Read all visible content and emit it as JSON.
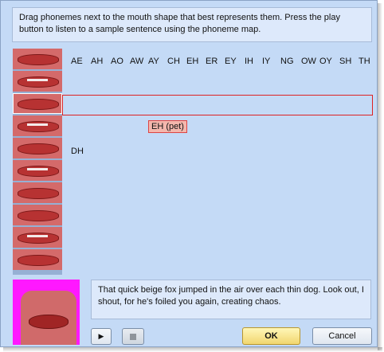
{
  "instructions": "Drag phonemes next to the mouth shape that best represents them. Press the play button to listen to a sample sentence using the phoneme map.",
  "phonemes": [
    "AE",
    "AH",
    "AO",
    "AW",
    "AY",
    "CH",
    "EH",
    "ER",
    "EY",
    "IH",
    "IY",
    "NG",
    "OW",
    "OY",
    "SH",
    "TH"
  ],
  "dragging_phoneme": "EH (pet)",
  "assigned_phoneme": "DH",
  "sentence": "That quick beige fox jumped in the air over each thin dog. Look out, I shout, for he's foiled you again, creating chaos.",
  "buttons": {
    "play": "▶",
    "ok": "OK",
    "cancel": "Cancel"
  },
  "colors": {
    "window_bg": "#c4daf6",
    "highlight_border": "#d22222",
    "drag_tag": "#f4b7ad",
    "ok_button": "#f1d66f"
  }
}
